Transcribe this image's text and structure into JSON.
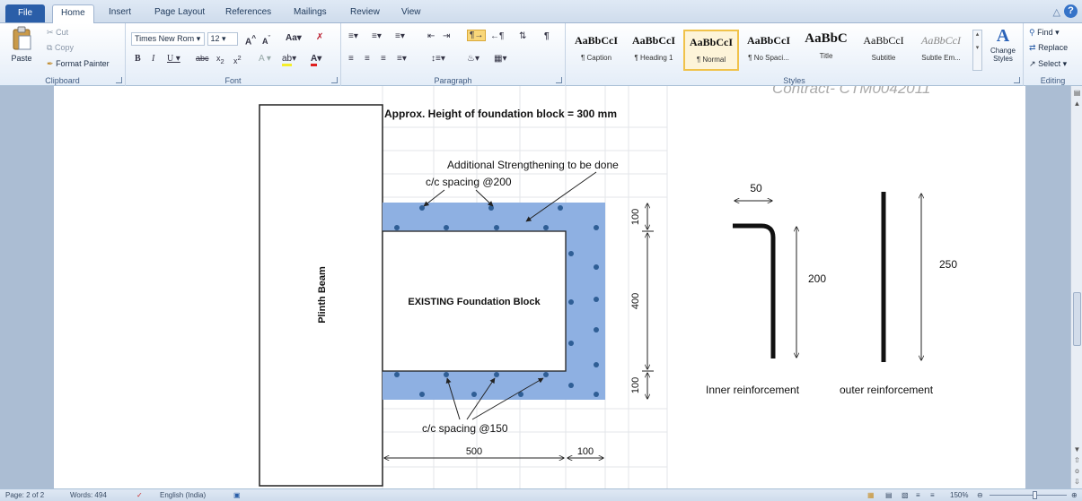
{
  "tabs": {
    "file": "File",
    "items": [
      "Home",
      "Insert",
      "Page Layout",
      "References",
      "Mailings",
      "Review",
      "View"
    ]
  },
  "clipboard": {
    "paste": "Paste",
    "cut": "Cut",
    "copy": "Copy",
    "format_painter": "Format Painter",
    "label": "Clipboard"
  },
  "font": {
    "family": "Times New Rom",
    "size": "12",
    "label": "Font"
  },
  "paragraph": {
    "label": "Paragraph"
  },
  "styles": {
    "label": "Styles",
    "items": [
      {
        "sample": "AaBbCcI",
        "name": "¶ Caption"
      },
      {
        "sample": "AaBbCcI",
        "name": "¶ Heading 1"
      },
      {
        "sample": "AaBbCcI",
        "name": "¶ Normal"
      },
      {
        "sample": "AaBbCcI",
        "name": "¶ No Spaci..."
      },
      {
        "sample": "AaBbC",
        "name": "Title"
      },
      {
        "sample": "AaBbCcI",
        "name": "Subtitle"
      },
      {
        "sample": "AaBbCcI",
        "name": "Subtle Em..."
      }
    ],
    "change_styles": "Change Styles"
  },
  "editing": {
    "label": "Editing",
    "find": "Find",
    "replace": "Replace",
    "select": "Select"
  },
  "document": {
    "header_fragment": "Contract- CTM0042011",
    "approx_height": "Approx. Height of foundation block = 300 mm",
    "additional": "Additional Strengthening to be done",
    "spacing_top": "c/c spacing @200",
    "spacing_bottom": "c/c spacing @150",
    "plinth_beam": "Plinth Beam",
    "existing_block": "EXISTING Foundation Block",
    "dim_top": "100",
    "dim_middle": "400",
    "dim_bottom": "100",
    "dim_width": "500",
    "dim_side": "100",
    "inner_hook": "50",
    "inner_height": "200",
    "outer_height": "250",
    "inner_label": "Inner reinforcement",
    "outer_label": "outer reinforcement"
  },
  "status": {
    "page": "Page: 2 of 2",
    "words": "Words: 494",
    "language": "English (India)",
    "zoom": "150%"
  },
  "colors": {
    "jacket": "#8eb0e2",
    "dot": "#2f5e95",
    "file_tab": "#2a5ea8"
  }
}
